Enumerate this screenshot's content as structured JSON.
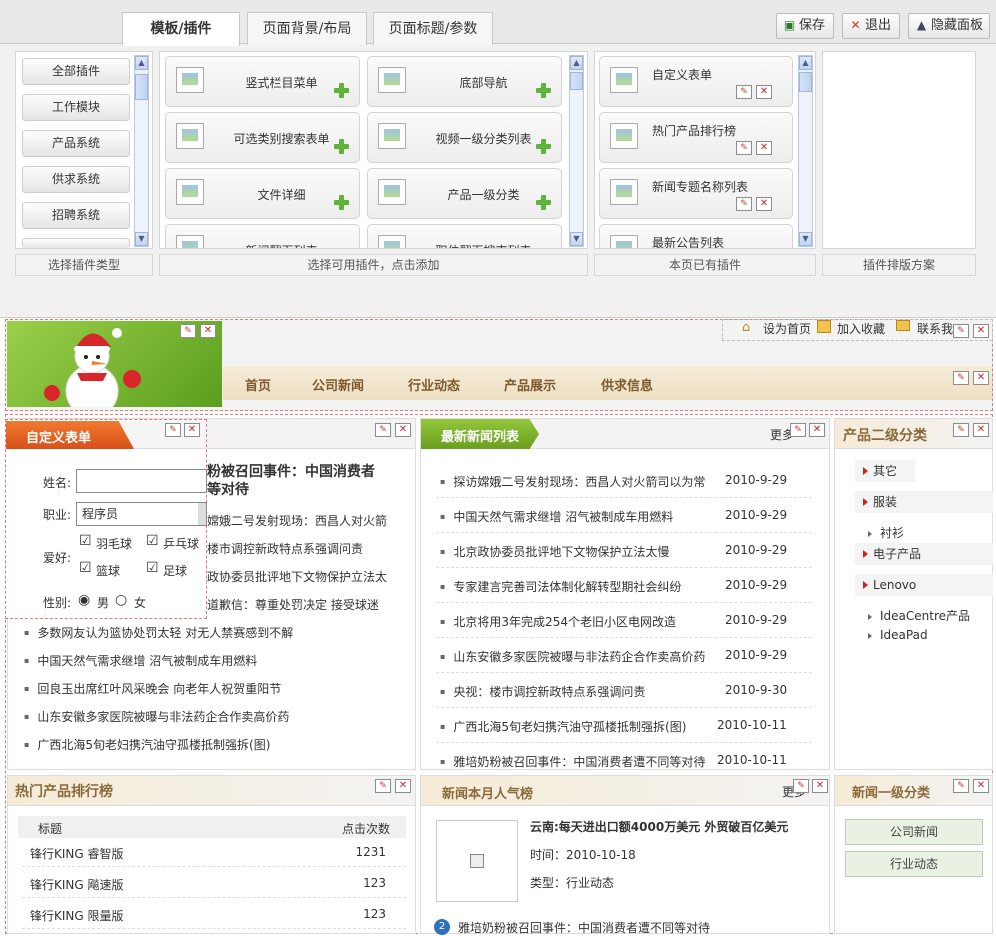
{
  "tabs": [
    "模板/插件",
    "页面背景/布局",
    "页面标题/参数"
  ],
  "toolbar": {
    "save": "保存",
    "exit": "退出",
    "hide": "隐藏面板"
  },
  "categories": [
    "全部插件",
    "工作模块",
    "产品系统",
    "供求系统",
    "招聘系统"
  ],
  "available_plugins": [
    "竖式栏目菜单",
    "底部导航",
    "可选类别搜索表单",
    "视频一级分类列表",
    "文件详细",
    "产品一级分类",
    "新闻翻页列表",
    "职位翻页搜索列表"
  ],
  "page_plugins": [
    "自定义表单",
    "热门产品排行榜",
    "新闻专题名称列表",
    "最新公告列表"
  ],
  "box_labels": {
    "types": "选择插件类型",
    "available": "选择可用插件，点击添加",
    "existing": "本页已有插件",
    "layout": "插件排版方案"
  },
  "site": {
    "top_links": [
      "设为首页",
      "加入收藏",
      "联系我"
    ],
    "nav": [
      "首页",
      "公司新闻",
      "行业动态",
      "产品展示",
      "供求信息"
    ]
  },
  "custom_form": {
    "title": "自定义表单",
    "name_label": "姓名:",
    "job_label": "职业:",
    "job_value": "程序员",
    "hobby_label": "爱好:",
    "hobbies": [
      "羽毛球",
      "乒乓球",
      "篮球",
      "足球"
    ],
    "gender_label": "性别:",
    "male": "男",
    "female": "女"
  },
  "news_col1": {
    "headline": "粉被召回事件：中国消费者\n等对待",
    "items_partial": [
      "嫦娥二号发射现场：西昌人对火箭",
      "楼市调控新政特点系强调问责",
      "政协委员批评地下文物保护立法太",
      "道歉信：尊重处罚决定 接受球迷"
    ],
    "items": [
      "多数网友认为篮协处罚太轻 对无人禁赛感到不解",
      "中国天然气需求继增 沼气被制成车用燃料",
      "回良玉出席红叶风采晚会 向老年人祝贺重阳节",
      "山东安徽多家医院被曝与非法药企合作卖高价药",
      "广西北海5旬老妇携汽油守孤楼抵制强拆(图)"
    ]
  },
  "latest_news": {
    "title": "最新新闻列表",
    "more": "更多",
    "items": [
      {
        "t": "探访嫦娥二号发射现场：西昌人对火箭司以为常",
        "d": "2010-9-29"
      },
      {
        "t": "中国天然气需求继增 沼气被制成车用燃料",
        "d": "2010-9-29"
      },
      {
        "t": "北京政协委员批评地下文物保护立法太慢",
        "d": "2010-9-29"
      },
      {
        "t": "专家建言完善司法体制化解转型期社会纠纷",
        "d": "2010-9-29"
      },
      {
        "t": "北京将用3年完成254个老旧小区电网改造",
        "d": "2010-9-29"
      },
      {
        "t": "山东安徽多家医院被曝与非法药企合作卖高价药",
        "d": "2010-9-29"
      },
      {
        "t": "央视：楼市调控新政特点系强调问责",
        "d": "2010-9-30"
      },
      {
        "t": "广西北海5旬老妇携汽油守孤楼抵制强拆(图)",
        "d": "2010-10-11"
      },
      {
        "t": "雅培奶粉被召回事件：中国消费者遭不同等对待",
        "d": "2010-10-11"
      }
    ]
  },
  "product_cat2": {
    "title": "产品二级分类",
    "items": [
      "其它",
      "服装",
      "衬衫",
      "电子产品",
      "Lenovo",
      "IdeaCentre产品",
      "IdeaPad"
    ]
  },
  "hot_products": {
    "title": "热门产品排行榜",
    "col_title": "标题",
    "col_clicks": "点击次数",
    "rows": [
      {
        "name": "锋行KING 睿智版",
        "clicks": "1231"
      },
      {
        "name": "锋行KING 飚速版",
        "clicks": "123"
      },
      {
        "name": "锋行KING 限量版",
        "clicks": "123"
      }
    ]
  },
  "monthly_news": {
    "title": "新闻本月人气榜",
    "more": "更多",
    "feature_title": "云南:每天进出口额4000万美元 外贸破百亿美元",
    "time": "时间：2010-10-18",
    "type": "类型：行业动态",
    "rank_num": "2",
    "rank_item": "雅培奶粉被召回事件：中国消费者遭不同等对待"
  },
  "news_cat1": {
    "title": "新闻一级分类",
    "items": [
      "公司新闻",
      "行业动态"
    ]
  },
  "colors": {
    "accent_orange": "#e8601c",
    "nav_bar": "#f0e4cc",
    "green_header": "#7fb52e"
  }
}
